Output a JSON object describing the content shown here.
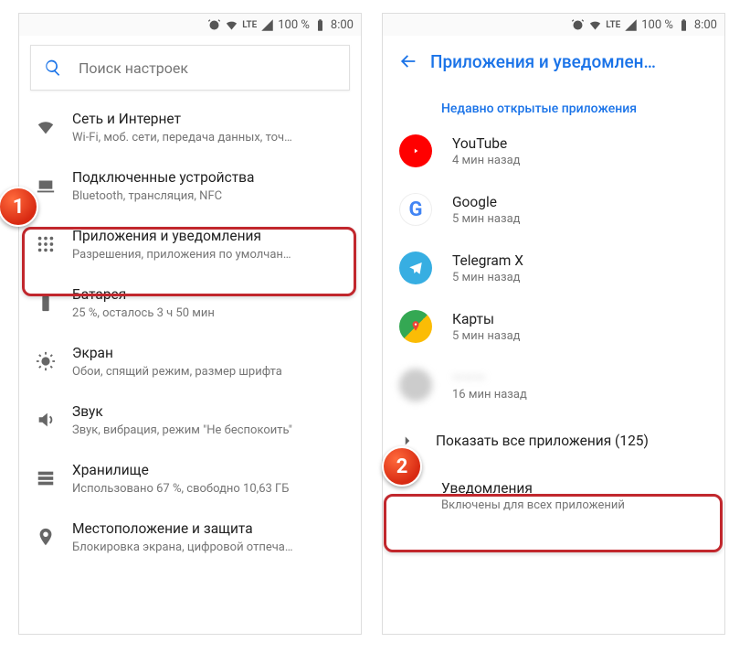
{
  "status": {
    "network_label": "LTE",
    "battery_pct": "100 %",
    "time": "8:00"
  },
  "left": {
    "search_placeholder": "Поиск настроек",
    "items": [
      {
        "title": "Сеть и Интернет",
        "subtitle": "Wi-Fi, моб. сети, передача данных, точ…"
      },
      {
        "title": "Подключенные устройства",
        "subtitle": "Bluetooth, трансляция, NFC"
      },
      {
        "title": "Приложения и уведомления",
        "subtitle": "Разрешения, приложения по умолчан…"
      },
      {
        "title": "Батарея",
        "subtitle": "25 %, осталось 3 ч 50 мин"
      },
      {
        "title": "Экран",
        "subtitle": "Обои, спящий режим, размер шрифта"
      },
      {
        "title": "Звук",
        "subtitle": "Звук, вибрация, режим \"Не беспокоить\""
      },
      {
        "title": "Хранилище",
        "subtitle": "Использовано 67 %, свободно 10,63 ГБ"
      },
      {
        "title": "Местоположение и защита",
        "subtitle": "Блокировка экрана, цифровой отпеча…"
      }
    ]
  },
  "right": {
    "header_title": "Приложения и уведомлен…",
    "section_label": "Недавно открытые приложения",
    "apps": [
      {
        "name": "YouTube",
        "time": "4 мин назад"
      },
      {
        "name": "Google",
        "time": "5 мин назад"
      },
      {
        "name": "Telegram X",
        "time": "5 мин назад"
      },
      {
        "name": "Карты",
        "time": "5 мин назад"
      },
      {
        "name": "———",
        "time": "16 мин назад",
        "blurred": true
      }
    ],
    "show_all_label": "Показать все приложения (125)",
    "notifications": {
      "title": "Уведомления",
      "subtitle": "Включены для всех приложений"
    }
  },
  "badges": {
    "one": "1",
    "two": "2"
  }
}
